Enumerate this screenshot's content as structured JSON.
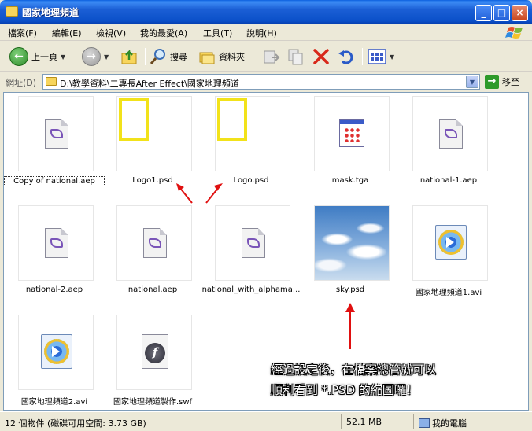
{
  "window": {
    "title": "國家地理頻道",
    "buttons": {
      "minimize": "_",
      "maximize": "□",
      "close": "×"
    }
  },
  "menu": [
    "檔案(F)",
    "編輯(E)",
    "檢視(V)",
    "我的最愛(A)",
    "工具(T)",
    "說明(H)"
  ],
  "toolbar": {
    "back_label": "上一頁",
    "search_label": "搜尋",
    "folders_label": "資料夾",
    "icons": [
      "back-icon",
      "forward-icon",
      "up-folder-icon",
      "search-icon",
      "folders-icon",
      "move-to-icon",
      "copy-to-icon",
      "delete-icon",
      "undo-icon",
      "views-icon"
    ]
  },
  "address": {
    "label": "網址(D)",
    "path": "D:\\教學資料\\二專長After Effect\\國家地理頻道",
    "go_label": "移至"
  },
  "files": [
    {
      "name": "Copy of national.aep",
      "thumb": "aep",
      "selected": true
    },
    {
      "name": "Logo1.psd",
      "thumb": "psd-frame"
    },
    {
      "name": "Logo.psd",
      "thumb": "psd-frame"
    },
    {
      "name": "mask.tga",
      "thumb": "tga"
    },
    {
      "name": "national-1.aep",
      "thumb": "aep"
    },
    {
      "name": "national-2.aep",
      "thumb": "aep"
    },
    {
      "name": "national.aep",
      "thumb": "aep"
    },
    {
      "name": "national_with_alphama...",
      "thumb": "aep"
    },
    {
      "name": "sky.psd",
      "thumb": "sky"
    },
    {
      "name": "國家地理頻道1.avi",
      "thumb": "avi"
    },
    {
      "name": "國家地理頻道2.avi",
      "thumb": "avi"
    },
    {
      "name": "國家地理頻道製作.swf",
      "thumb": "swf"
    }
  ],
  "annotation": {
    "line1": "經過設定後，在檔案總管就可以",
    "line2": "順利看到 *.PSD 的縮圖囉！"
  },
  "status": {
    "objects": "12 個物件 (磁碟可用空間: 3.73 GB)",
    "size": "52.1 MB",
    "location": "我的電腦"
  },
  "colors": {
    "titlebar": "#0A4FC8",
    "annotation_arrow": "#E01010",
    "chrome": "#ECE9D8"
  }
}
